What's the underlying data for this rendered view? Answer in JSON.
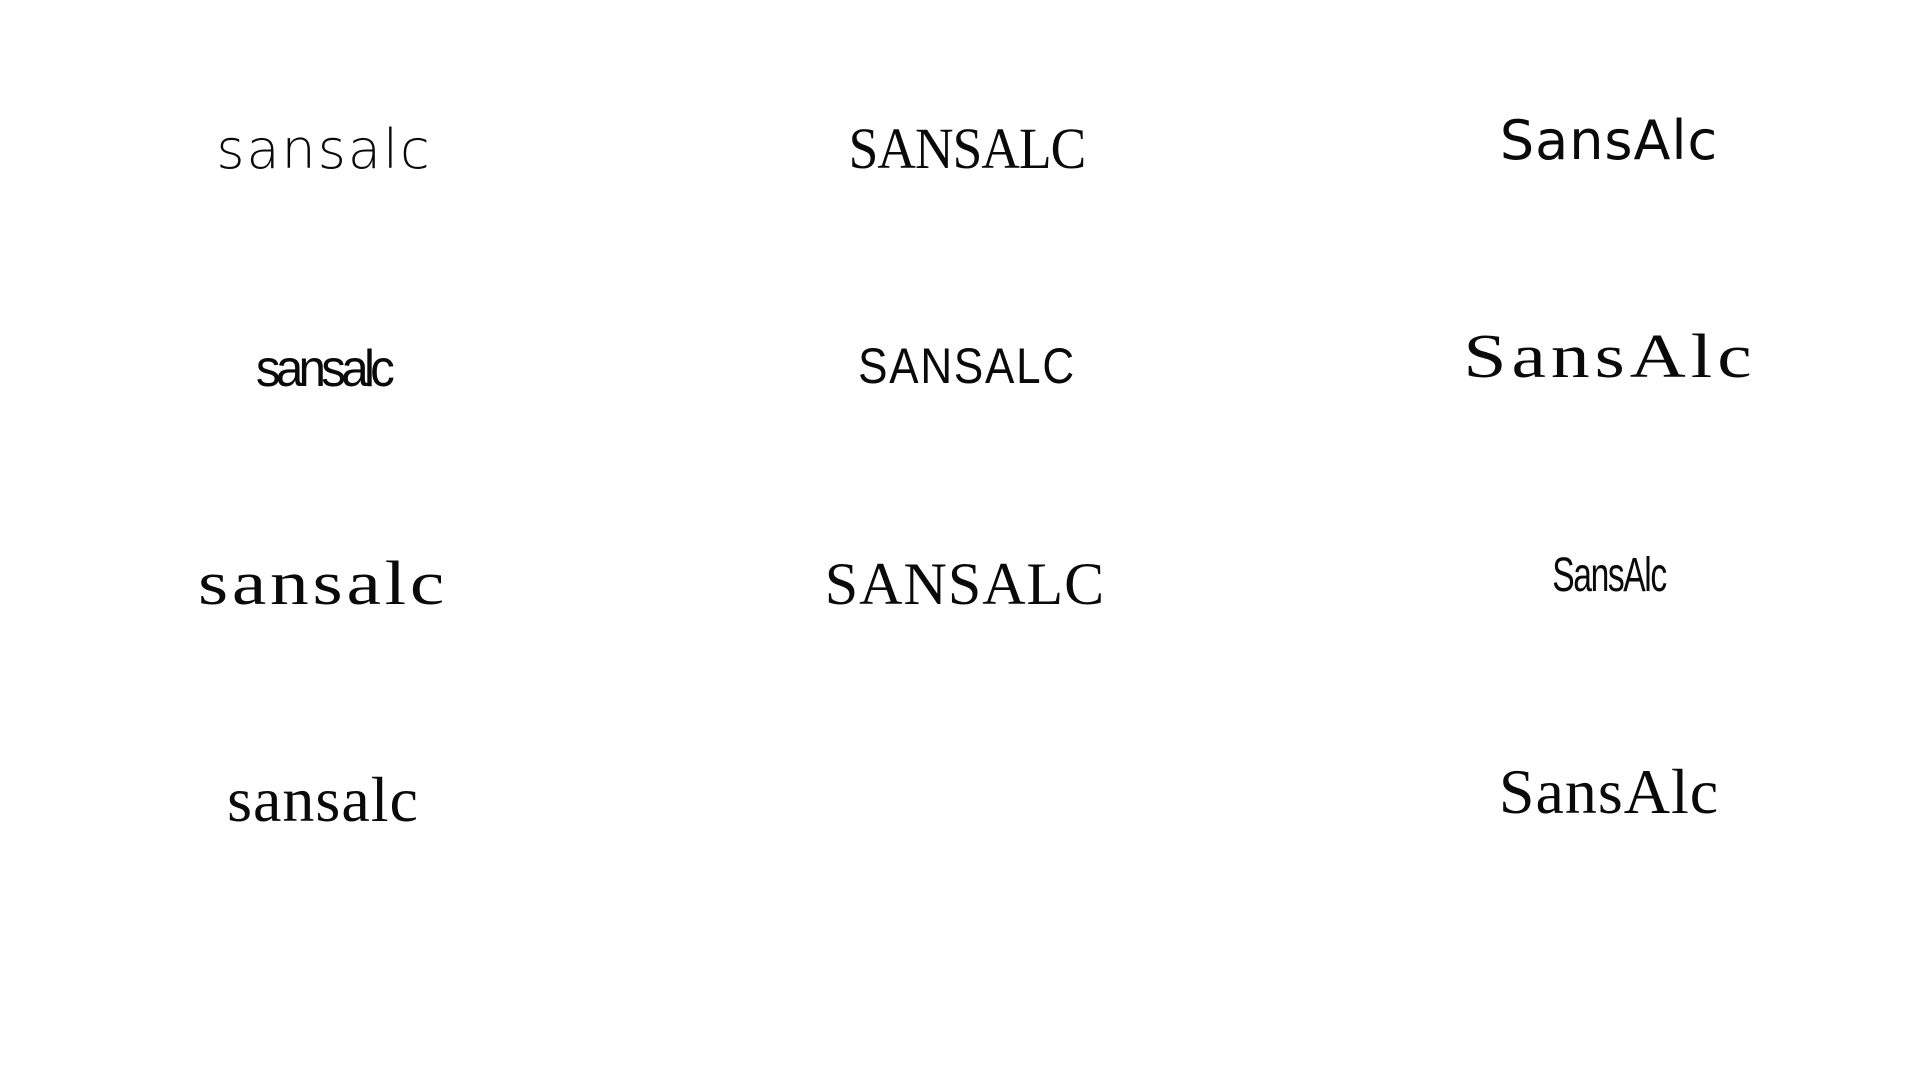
{
  "samples": {
    "col1": [
      "sansalc",
      "sansalc",
      "sansalc",
      "sansalc"
    ],
    "col2": [
      "SANSALC",
      "SANSALC",
      "SANSALC"
    ],
    "col3": [
      "SansAlc",
      "SansAlc",
      "SansAlc",
      "SansAlc"
    ]
  },
  "colors": {
    "background": "#ffffff",
    "text": "#0a0a0a"
  }
}
